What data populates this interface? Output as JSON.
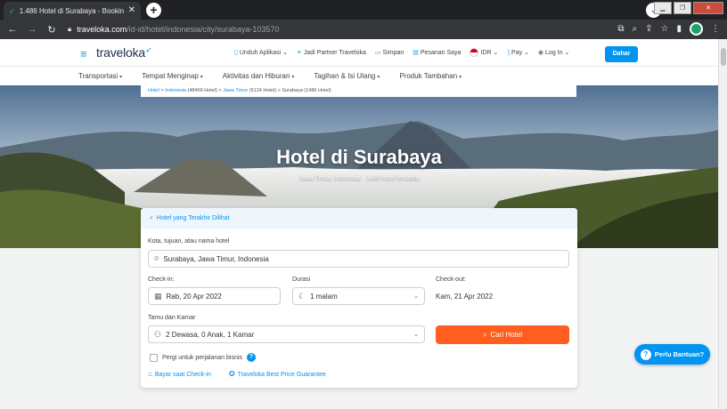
{
  "browser": {
    "tab_title": "1.486 Hotel di Surabaya - Bookin",
    "url_host": "traveloka.com",
    "url_path": "/id-id/hotel/indonesia/city/surabaya-103570"
  },
  "header": {
    "logo": "traveloka",
    "nav": [
      {
        "label": "Unduh Aplikasi",
        "icon": "phone-icon"
      },
      {
        "label": "Jadi Partner Traveloka",
        "icon": "handshake-icon"
      },
      {
        "label": "Simpan",
        "icon": "bookmark-icon"
      },
      {
        "label": "Pesanan Saya",
        "icon": "receipt-icon"
      },
      {
        "label": "IDR",
        "icon": "flag-icon"
      },
      {
        "label": "Pay",
        "icon": "pay-icon"
      },
      {
        "label": "Log In",
        "icon": "user-icon"
      }
    ],
    "register_label": "Dahar"
  },
  "category_nav": [
    "Transportasi",
    "Tempat Menginap",
    "Aktivitas dan Hiburan",
    "Tagihan & Isi Ulang",
    "Produk Tambahan"
  ],
  "breadcrumb": {
    "home": "Hotel",
    "country": "Indonesia",
    "country_count": "(48466 Hotel)",
    "province": "Jawa Timur",
    "province_count": "(5124 Hotel)",
    "city": "Surabaya (1486 Hotel)"
  },
  "hero": {
    "title": "Hotel di Surabaya",
    "subtitle": "Jawa Timur, Indonesia · 1486 hotel tersedia"
  },
  "search": {
    "recent_label": "Hotel yang Terakhir Dilihat",
    "destination_label": "Kota, tujuan, atau nama hotel",
    "destination_value": "Surabaya, Jawa Timur, Indonesia",
    "checkin_label": "Check-in:",
    "checkin_value": "Rab, 20 Apr 2022",
    "duration_label": "Durasi",
    "duration_value": "1 malam",
    "checkout_label": "Check-out:",
    "checkout_value": "Kam, 21 Apr 2022",
    "guests_label": "Tamu dan Kamar",
    "guests_value": "2 Dewasa, 0 Anak, 1 Kamar",
    "search_button": "Cari Hotel",
    "business_label": "Pergi untuk perjalanan bisnis",
    "pay_at_hotel": "Bayar saat Check-in",
    "price_guarantee": "Traveloka Best Price Guarantee"
  },
  "help_button": "Perlu Bantuan?",
  "colors": {
    "accent": "#0194f3",
    "cta": "#ff5e1f"
  }
}
